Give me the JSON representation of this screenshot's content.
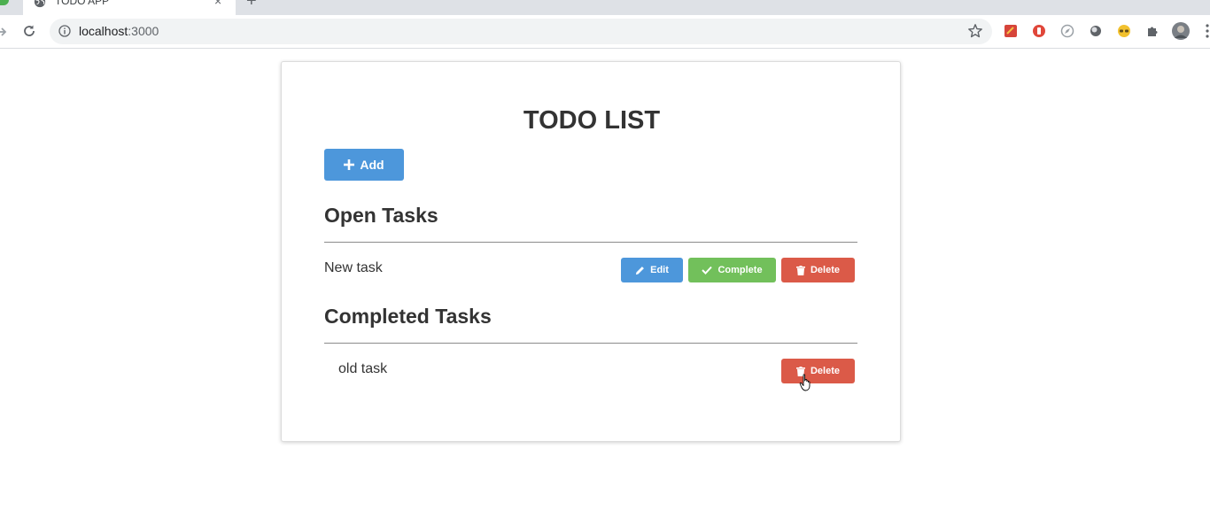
{
  "browser": {
    "tab_title": "TODO APP",
    "tab_close": "×",
    "new_tab": "+",
    "url_host": "localhost",
    "url_port": ":3000"
  },
  "app": {
    "title": "TODO LIST",
    "add_label": "Add",
    "open_section": {
      "title": "Open Tasks",
      "tasks": [
        {
          "text": "New task",
          "edit_label": "Edit",
          "complete_label": "Complete",
          "delete_label": "Delete"
        }
      ]
    },
    "completed_section": {
      "title": "Completed Tasks",
      "tasks": [
        {
          "text": "old task",
          "delete_label": "Delete"
        }
      ]
    }
  },
  "colors": {
    "primary": "#4d97db",
    "success": "#72c05b",
    "danger": "#db5a48",
    "text": "#333333"
  }
}
